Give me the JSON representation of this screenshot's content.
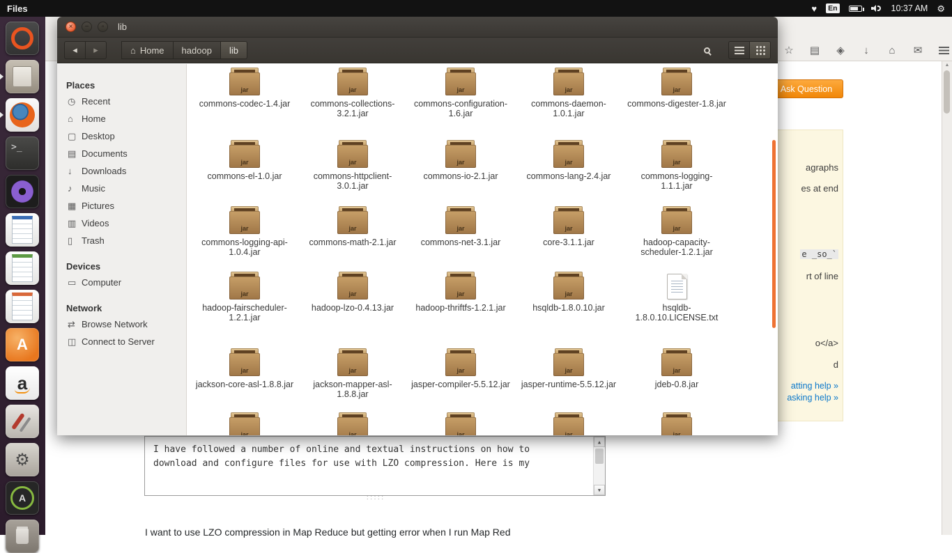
{
  "glyphs": {
    "heart": "♥",
    "gear": "⚙",
    "arrow_up": "▲",
    "arrow_down": "▼",
    "back": "◂",
    "forward": "▸"
  },
  "top_bar": {
    "app_name": "Files",
    "keyboard_layout": "En",
    "time": "10:37 AM"
  },
  "launcher": {
    "items": [
      {
        "name": "launcher-dash-home",
        "style": "dash",
        "glyph": ""
      },
      {
        "name": "launcher-files",
        "style": "files-tile",
        "glyph": ""
      },
      {
        "name": "launcher-firefox",
        "style": "firefox",
        "glyph": ""
      },
      {
        "name": "launcher-terminal",
        "style": "terminal",
        "glyph": ">_"
      },
      {
        "name": "launcher-media-player",
        "style": "media",
        "glyph": ""
      },
      {
        "name": "launcher-libreoffice-writer",
        "style": "writer",
        "glyph": ""
      },
      {
        "name": "launcher-libreoffice-calc",
        "style": "calc",
        "glyph": ""
      },
      {
        "name": "launcher-libreoffice-impress",
        "style": "impress",
        "glyph": ""
      },
      {
        "name": "launcher-software-center",
        "style": "software",
        "glyph": "A"
      },
      {
        "name": "launcher-amazon",
        "style": "amazon",
        "glyph": "a"
      },
      {
        "name": "launcher-tweak-tool",
        "style": "tweak",
        "glyph": ""
      },
      {
        "name": "launcher-system-settings",
        "style": "settings",
        "glyph": "⚙"
      },
      {
        "name": "launcher-software-updater",
        "style": "updater",
        "glyph": "A"
      },
      {
        "name": "launcher-trash",
        "style": "trash-tile",
        "glyph": ""
      }
    ]
  },
  "window": {
    "title": "lib",
    "jar_badge": "jar",
    "controls": {
      "close": "×",
      "minimize": "−",
      "maximize": "▫"
    },
    "breadcrumb": [
      {
        "label": "Home",
        "icon": "⌂",
        "state": "normal",
        "name": "breadcrumb-home"
      },
      {
        "label": "hadoop",
        "icon": "",
        "state": "normal",
        "name": "breadcrumb-hadoop"
      },
      {
        "label": "lib",
        "icon": "",
        "state": "current",
        "name": "breadcrumb-lib"
      }
    ],
    "sidebar_rows": [
      {
        "kind": "header",
        "label": "Places",
        "icon": "",
        "name": "sidebar-section-places",
        "inter": "false"
      },
      {
        "kind": "item",
        "label": "Recent",
        "icon": "◷",
        "name": "sidebar-item-recent",
        "inter": "true"
      },
      {
        "kind": "item",
        "label": "Home",
        "icon": "⌂",
        "name": "sidebar-item-home",
        "inter": "true"
      },
      {
        "kind": "item",
        "label": "Desktop",
        "icon": "▢",
        "name": "sidebar-item-desktop",
        "inter": "true"
      },
      {
        "kind": "item",
        "label": "Documents",
        "icon": "▤",
        "name": "sidebar-item-documents",
        "inter": "true"
      },
      {
        "kind": "item",
        "label": "Downloads",
        "icon": "↓",
        "name": "sidebar-item-downloads",
        "inter": "true"
      },
      {
        "kind": "item",
        "label": "Music",
        "icon": "♪",
        "name": "sidebar-item-music",
        "inter": "true"
      },
      {
        "kind": "item",
        "label": "Pictures",
        "icon": "▦",
        "name": "sidebar-item-pictures",
        "inter": "true"
      },
      {
        "kind": "item",
        "label": "Videos",
        "icon": "▥",
        "name": "sidebar-item-videos",
        "inter": "true"
      },
      {
        "kind": "item",
        "label": "Trash",
        "icon": "▯",
        "name": "sidebar-item-trash",
        "inter": "true"
      },
      {
        "kind": "header",
        "label": "Devices",
        "icon": "",
        "name": "sidebar-section-devices",
        "inter": "false"
      },
      {
        "kind": "item",
        "label": "Computer",
        "icon": "▭",
        "name": "sidebar-item-computer",
        "inter": "true"
      },
      {
        "kind": "header",
        "label": "Network",
        "icon": "",
        "name": "sidebar-section-network",
        "inter": "false"
      },
      {
        "kind": "item",
        "label": "Browse Network",
        "icon": "⇄",
        "name": "sidebar-item-browse-network",
        "inter": "true"
      },
      {
        "kind": "item",
        "label": "Connect to Server",
        "icon": "◫",
        "name": "sidebar-item-connect-to-server",
        "inter": "true"
      }
    ],
    "files": [
      {
        "label": "commons-codec-1.4.jar",
        "type": "jar"
      },
      {
        "label": "commons-collections-3.2.1.jar",
        "type": "jar"
      },
      {
        "label": "commons-configuration-1.6.jar",
        "type": "jar"
      },
      {
        "label": "commons-daemon-1.0.1.jar",
        "type": "jar"
      },
      {
        "label": "commons-digester-1.8.jar",
        "type": "jar"
      },
      {
        "label": "commons-el-1.0.jar",
        "type": "jar"
      },
      {
        "label": "commons-httpclient-3.0.1.jar",
        "type": "jar"
      },
      {
        "label": "commons-io-2.1.jar",
        "type": "jar"
      },
      {
        "label": "commons-lang-2.4.jar",
        "type": "jar"
      },
      {
        "label": "commons-logging-1.1.1.jar",
        "type": "jar"
      },
      {
        "label": "commons-logging-api-1.0.4.jar",
        "type": "jar"
      },
      {
        "label": "commons-math-2.1.jar",
        "type": "jar"
      },
      {
        "label": "commons-net-3.1.jar",
        "type": "jar"
      },
      {
        "label": "core-3.1.1.jar",
        "type": "jar"
      },
      {
        "label": "hadoop-capacity-scheduler-1.2.1.jar",
        "type": "jar"
      },
      {
        "label": "hadoop-fairscheduler-1.2.1.jar",
        "type": "jar"
      },
      {
        "label": "hadoop-lzo-0.4.13.jar",
        "type": "jar"
      },
      {
        "label": "hadoop-thriftfs-1.2.1.jar",
        "type": "jar"
      },
      {
        "label": "hsqldb-1.8.0.10.jar",
        "type": "jar"
      },
      {
        "label": "hsqldb-1.8.0.10.LICENSE.txt",
        "type": "txt"
      },
      {
        "label": "jackson-core-asl-1.8.8.jar",
        "type": "jar"
      },
      {
        "label": "jackson-mapper-asl-1.8.8.jar",
        "type": "jar"
      },
      {
        "label": "jasper-compiler-5.5.12.jar",
        "type": "jar"
      },
      {
        "label": "jasper-runtime-5.5.12.jar",
        "type": "jar"
      },
      {
        "label": "jdeb-0.8.jar",
        "type": "jar"
      },
      {
        "label": "",
        "type": "jar"
      },
      {
        "label": "",
        "type": "jar"
      },
      {
        "label": "",
        "type": "jar"
      },
      {
        "label": "",
        "type": "jar"
      },
      {
        "label": "",
        "type": "jar"
      }
    ]
  },
  "browser": {
    "ask_question_label": "Ask Question",
    "toolbar_icons": [
      {
        "name": "bookmark-star-icon",
        "glyph": "☆",
        "style": "plain"
      },
      {
        "name": "reading-list-icon",
        "glyph": "▤",
        "style": "plain"
      },
      {
        "name": "bookmarks-icon",
        "glyph": "◈",
        "style": "plain"
      },
      {
        "name": "downloads-icon",
        "glyph": "↓",
        "style": "plain"
      },
      {
        "name": "home-icon",
        "glyph": "⌂",
        "style": "plain"
      },
      {
        "name": "messaging-icon",
        "glyph": "✉",
        "style": "plain"
      },
      {
        "name": "menu-icon",
        "glyph": "",
        "style": "menu"
      }
    ],
    "help_fragments": [
      {
        "text": "agraphs",
        "style": "plain",
        "inter": "false"
      },
      {
        "text": "es at end",
        "style": "plain",
        "inter": "false"
      },
      {
        "text": "e _so_`",
        "style": "code",
        "inter": "false"
      },
      {
        "text": "rt of line",
        "style": "plain",
        "inter": "false"
      },
      {
        "text": "o</a>",
        "style": "plain",
        "inter": "false"
      },
      {
        "text": "d",
        "style": "plain",
        "inter": "false"
      },
      {
        "text": "atting help »",
        "style": "link",
        "inter": "true"
      },
      {
        "text": "asking help »",
        "style": "link",
        "inter": "true"
      }
    ]
  },
  "editor": {
    "lines": [
      "I have followed a number of online and textual instructions on how to",
      "download and configure files for use with LZO compression. Here is my"
    ],
    "grip": "·····",
    "bottom_text": "I want to use LZO compression in Map Reduce but getting error when I run Map Red"
  }
}
